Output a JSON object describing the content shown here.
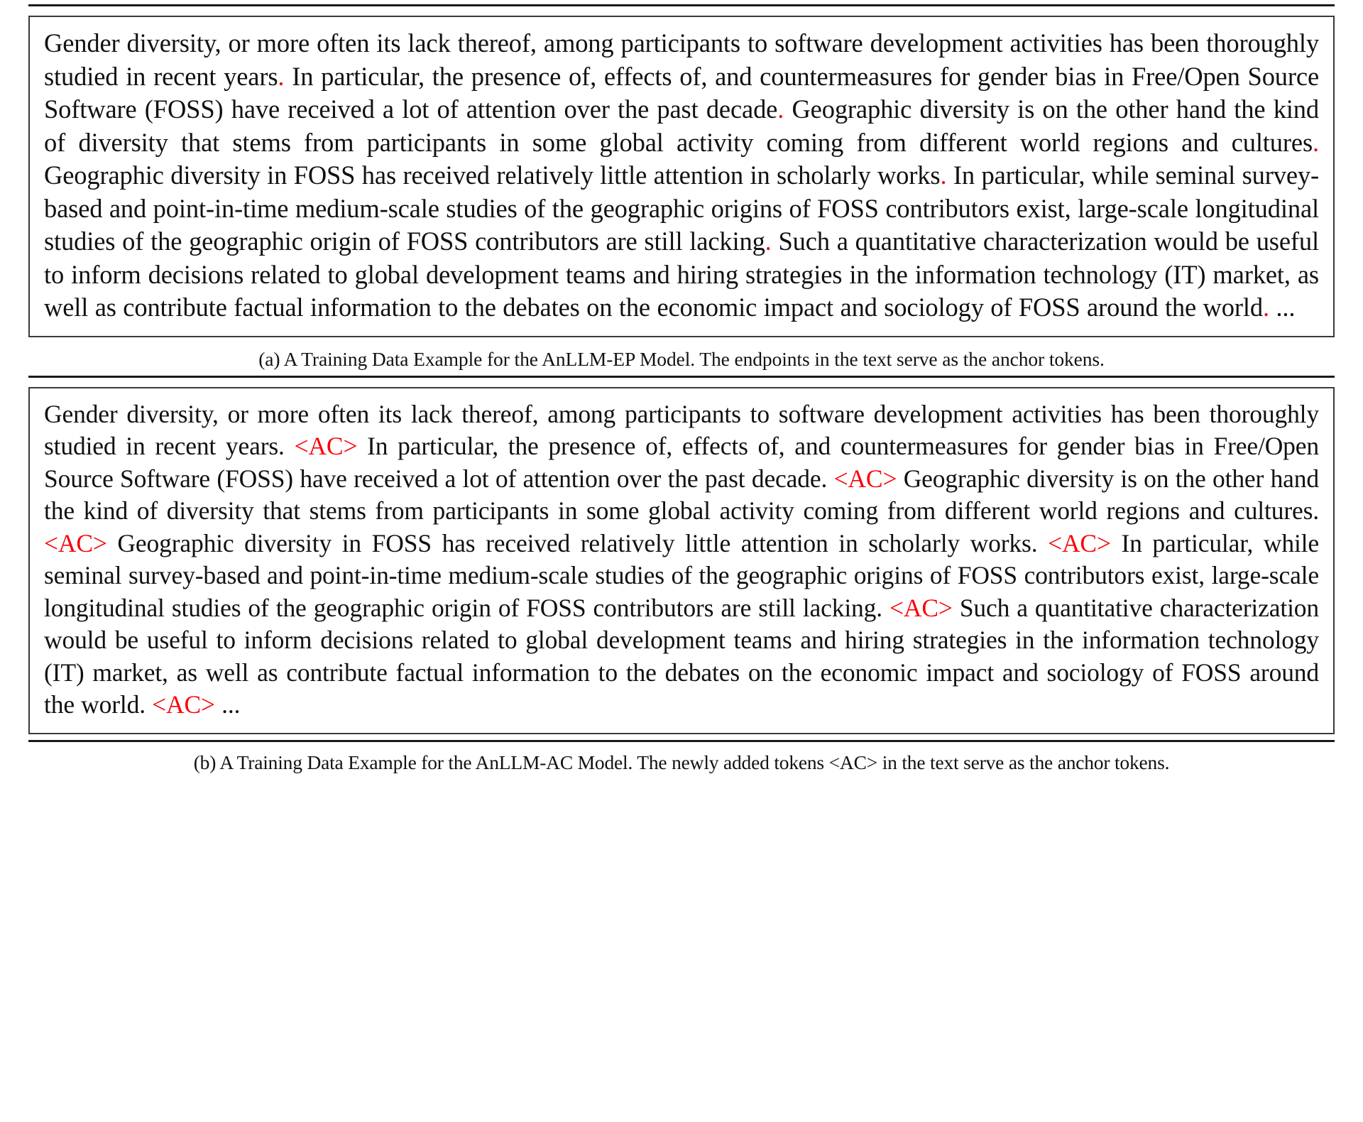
{
  "figure": {
    "panel_a": {
      "id": "a",
      "segments": [
        {
          "text": "Gender diversity, or more often its lack thereof, among participants to software development activities has been thoroughly studied in recent years",
          "color": "black"
        },
        {
          "text": ".",
          "color": "red"
        },
        {
          "text": " In particular, the presence of, effects of, and countermeasures for gender bias in Free/Open Source Software (FOSS) have received a lot of attention over the past decade",
          "color": "black"
        },
        {
          "text": ".",
          "color": "red"
        },
        {
          "text": " Geographic diversity is on the other hand the kind of diversity that stems from participants in some global activity coming from different world regions and cultures",
          "color": "black"
        },
        {
          "text": ".",
          "color": "red"
        },
        {
          "text": " Geographic diversity in FOSS has received relatively little attention in scholarly works",
          "color": "black"
        },
        {
          "text": ".",
          "color": "red"
        },
        {
          "text": " In particular, while seminal survey-based and point-in-time medium-scale studies of the geographic origins of FOSS contributors exist, large-scale longitudinal studies of the geographic origin of FOSS contributors are still lacking",
          "color": "black"
        },
        {
          "text": ".",
          "color": "red"
        },
        {
          "text": " Such a quantitative characterization would be useful to inform decisions related to global development teams and hiring strategies in the information technology (IT) market, as well as contribute factual information to the debates on the economic impact and sociology of FOSS around the world",
          "color": "black"
        },
        {
          "text": ".",
          "color": "red"
        },
        {
          "text": " ...",
          "color": "black"
        }
      ],
      "caption": "(a) A Training Data Example for the AnLLM-EP Model. The endpoints in the text serve as the anchor tokens."
    },
    "panel_b": {
      "id": "b",
      "anchor_token": "<AC>",
      "segments": [
        {
          "text": "Gender diversity, or more often its lack thereof, among participants to software development activities has been thoroughly studied in recent years. ",
          "color": "black"
        },
        {
          "text": "<AC>",
          "color": "red"
        },
        {
          "text": " In particular, the presence of, effects of, and countermeasures for gender bias in Free/Open Source Software (FOSS) have received a lot of attention over the past decade. ",
          "color": "black"
        },
        {
          "text": "<AC>",
          "color": "red"
        },
        {
          "text": " Geographic diversity is on the other hand the kind of diversity that stems from participants in some global activity coming from different world regions and cultures.",
          "color": "black"
        },
        {
          "text": "<AC>",
          "color": "red"
        },
        {
          "text": " Geographic diversity in FOSS has received relatively little attention in scholarly works. ",
          "color": "black"
        },
        {
          "text": "<AC>",
          "color": "red"
        },
        {
          "text": " In particular, while seminal survey-based and point-in-time medium-scale studies of the geographic origins of FOSS contributors exist, large-scale longitudinal studies of the geographic origin of FOSS contributors are still lacking. ",
          "color": "black"
        },
        {
          "text": "<AC>",
          "color": "red"
        },
        {
          "text": " Such a quantitative characterization would be useful to inform decisions related to global development teams and hiring strategies in the information technology (IT) market, as well as contribute factual information to the debates on the economic impact and sociology of FOSS around the world. ",
          "color": "black"
        },
        {
          "text": "<AC>",
          "color": "red"
        },
        {
          "text": " ...",
          "color": "black"
        }
      ],
      "caption": "(b) A Training Data Example for the AnLLM-AC Model. The newly added tokens <AC> in the text serve as the anchor tokens."
    },
    "colors": {
      "anchor_red": "#fb0007",
      "endpoint_red": "#e8121a",
      "text_black": "#111111",
      "box_border": "#3a3a3a",
      "rule": "#1a1a1a"
    }
  }
}
